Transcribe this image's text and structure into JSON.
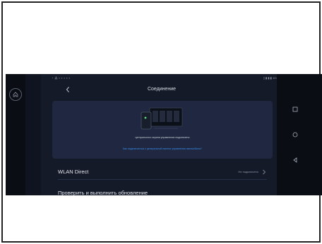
{
  "status_bar": {
    "left_icons": "⁝ ⁂ ▪ ▪ ▪ ▪ ▪",
    "right_text": "▯ ▮ ▮ ▮ 12:00"
  },
  "header": {
    "title": "Соединение"
  },
  "connection_card": {
    "caption": "центрального экрана управления подключено",
    "help_link": "Как подключиться к центральной панели управления автомобиля?"
  },
  "list": {
    "items": [
      {
        "label": "WLAN Direct",
        "value": "Не подключено"
      },
      {
        "label": "Проверить и выполнить обновление",
        "value": ""
      }
    ]
  },
  "colors": {
    "background": "#0f1420",
    "card": "#1f2840",
    "link": "#3a8ef0",
    "text": "#e3e6ee"
  },
  "icons": {
    "home": "home-icon",
    "back": "chevron-left-icon",
    "square": "square-icon",
    "circle": "circle-icon",
    "triangle": "triangle-back-icon",
    "chevron": "chevron-right-icon"
  }
}
